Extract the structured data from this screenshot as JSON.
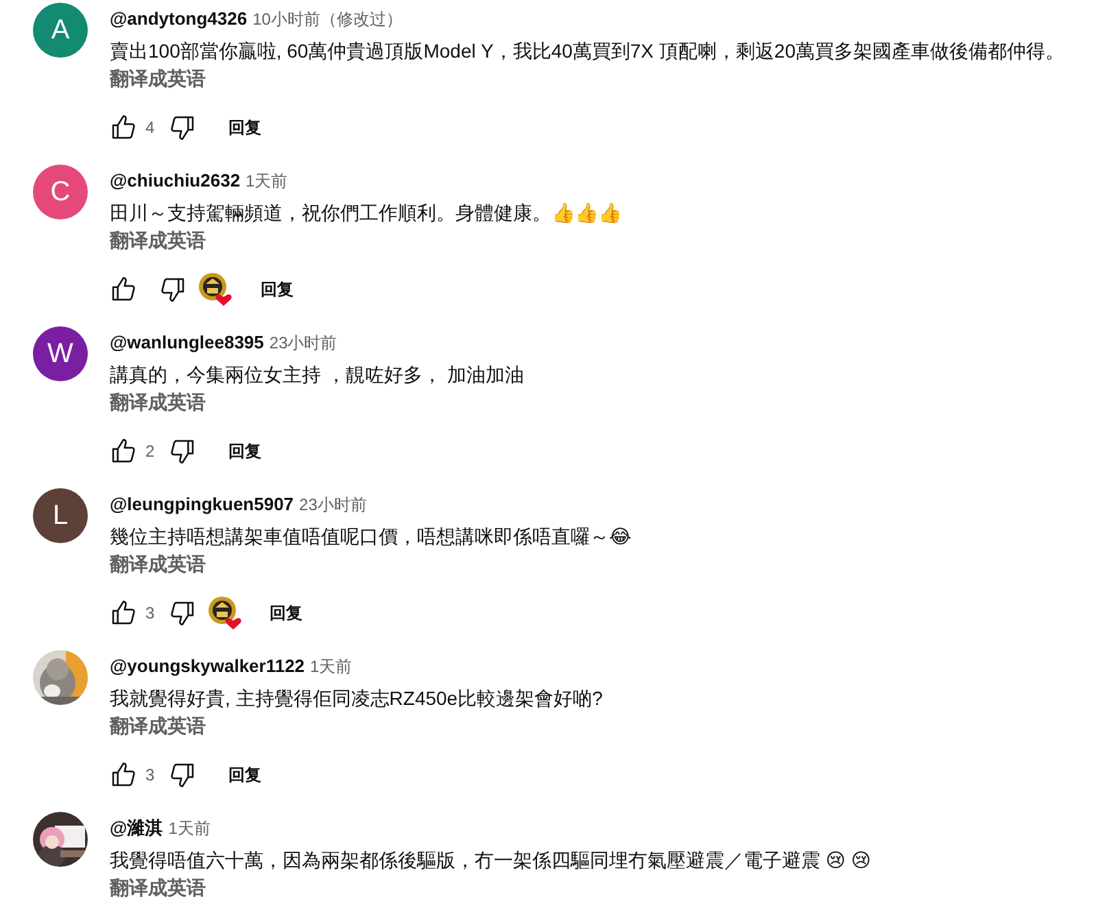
{
  "comments": [
    {
      "avatar": {
        "kind": "letter",
        "letter": "A",
        "color": "#138a72"
      },
      "author": "@andytong4326",
      "time": "10小时前（修改过）",
      "text": "賣出100部當你贏啦, 60萬仲貴過頂版Model Y，我比40萬買到7X 頂配喇，剩返20萬買多架國產車做後備都仲得。",
      "translate": "翻译成英语",
      "actions": {
        "likes": "4",
        "hearted": false,
        "reply": "回复"
      }
    },
    {
      "avatar": {
        "kind": "letter",
        "letter": "C",
        "color": "#e5497a"
      },
      "author": "@chiuchiu2632",
      "time": "1天前",
      "text": "田川～支持駕輛頻道，祝你們工作順利。身體健康。👍👍👍",
      "translate": "翻译成英语",
      "actions": {
        "hearted": true,
        "reply": "回复"
      }
    },
    {
      "avatar": {
        "kind": "letter",
        "letter": "W",
        "color": "#7b1fa2"
      },
      "author": "@wanlunglee8395",
      "time": "23小时前",
      "text": "講真的，今集兩位女主持 ，靚咗好多， 加油加油",
      "translate": "翻译成英语",
      "actions": {
        "likes": "2",
        "hearted": false,
        "reply": "回复"
      }
    },
    {
      "avatar": {
        "kind": "letter",
        "letter": "L",
        "color": "#5d4037"
      },
      "author": "@leungpingkuen5907",
      "time": "23小时前",
      "text": "幾位主持唔想講架車值唔值呢口價，唔想講咪即係唔直囉～😂",
      "translate": "翻译成英语",
      "actions": {
        "likes": "3",
        "hearted": true,
        "reply": "回复"
      }
    },
    {
      "author": "@youngskywalker1122",
      "time": "1天前",
      "text": "我就覺得好貴, 主持覺得佢同凌志RZ450e比較邊架會好啲?",
      "translate": "翻译成英语",
      "actions": {
        "likes": "3",
        "hearted": false,
        "reply": "回复"
      }
    },
    {
      "author": "@濰淇",
      "time": "1天前",
      "text": "我覺得唔值六十萬，因為兩架都係後驅版，冇一架係四驅同埋冇氣壓避震／電子避震 😢 😢",
      "translate": "翻译成英语"
    }
  ]
}
